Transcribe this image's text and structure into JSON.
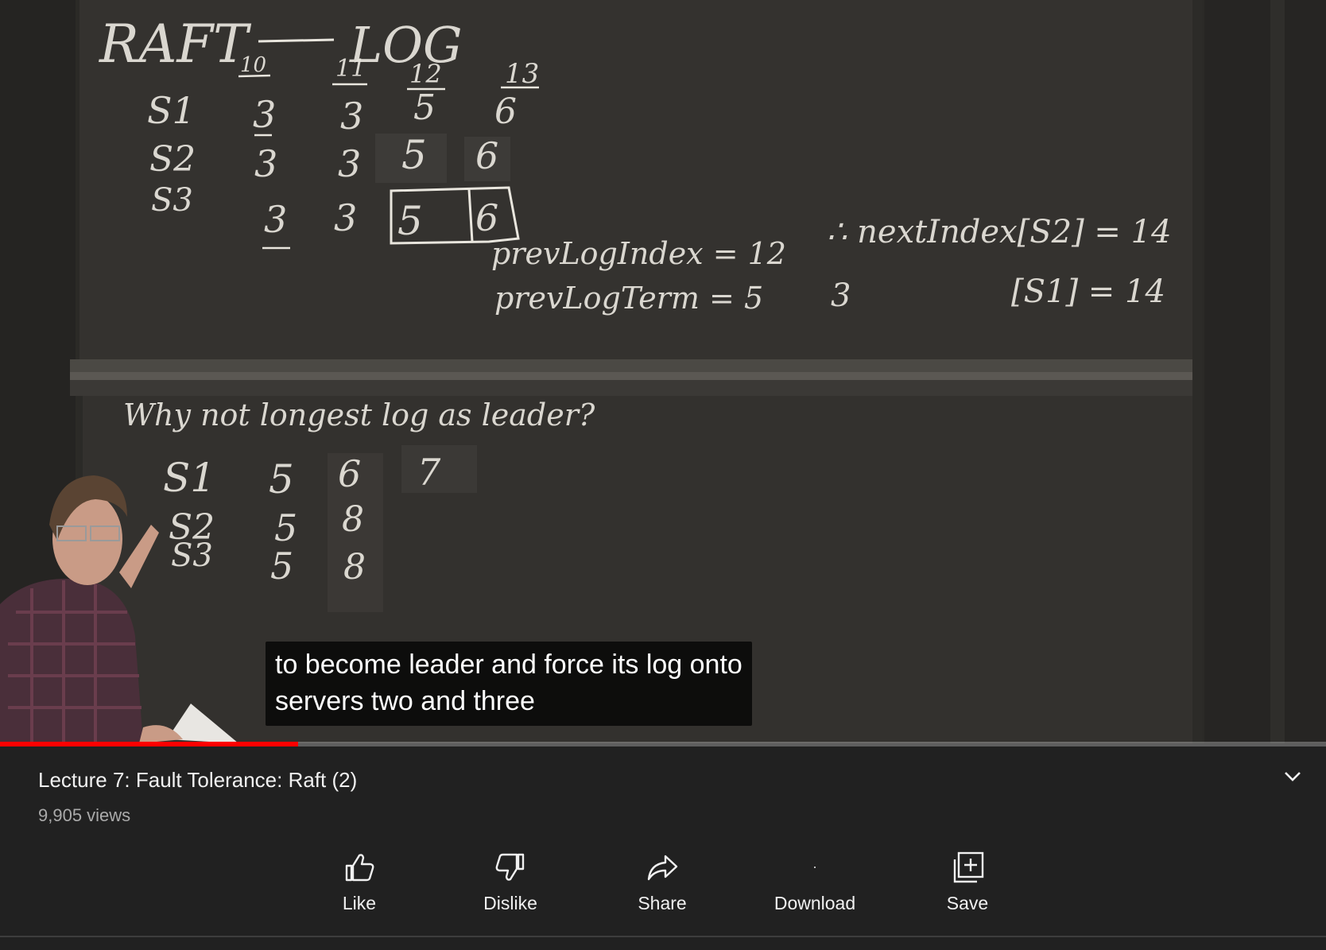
{
  "video": {
    "board_top": {
      "heading_raft": "RAFT",
      "heading_log": "LOG",
      "indices": [
        "10",
        "11",
        "12",
        "13"
      ],
      "rows": [
        {
          "server": "S1",
          "terms": [
            "3",
            "3",
            "5",
            "6"
          ]
        },
        {
          "server": "S2",
          "terms": [
            "3",
            "3",
            "5",
            "6"
          ]
        },
        {
          "server": "S3",
          "terms": [
            "3",
            "3",
            "5",
            "6"
          ]
        }
      ],
      "prev_log_index": "prevLogIndex = 12",
      "prev_log_term": "prevLogTerm = 5",
      "prev_log_term_alt": "3",
      "next_index_s2": "∴ nextIndex[S2] = 14",
      "next_index_s1": "[S1] = 14"
    },
    "board_bottom": {
      "question": "Why not longest log as leader?",
      "rows": [
        {
          "server": "S1",
          "terms": [
            "5",
            "6",
            "7"
          ]
        },
        {
          "server": "S2",
          "terms": [
            "5",
            "8"
          ]
        },
        {
          "server": "S3",
          "terms": [
            "5",
            "8"
          ]
        }
      ]
    },
    "captions": {
      "line1": "to become leader and force its log onto",
      "line2": "servers two and three"
    },
    "progress_fraction": 0.225,
    "progress_color": "#ff0000"
  },
  "meta": {
    "title": "Lecture 7: Fault Tolerance: Raft (2)",
    "views": "9,905 views"
  },
  "actions": [
    {
      "id": "like",
      "label": "Like",
      "icon": "thumbs-up-icon"
    },
    {
      "id": "dislike",
      "label": "Dislike",
      "icon": "thumbs-down-icon"
    },
    {
      "id": "share",
      "label": "Share",
      "icon": "share-arrow-icon"
    },
    {
      "id": "download",
      "label": "Download",
      "icon": "download-icon"
    },
    {
      "id": "save",
      "label": "Save",
      "icon": "add-to-playlist-icon"
    }
  ]
}
